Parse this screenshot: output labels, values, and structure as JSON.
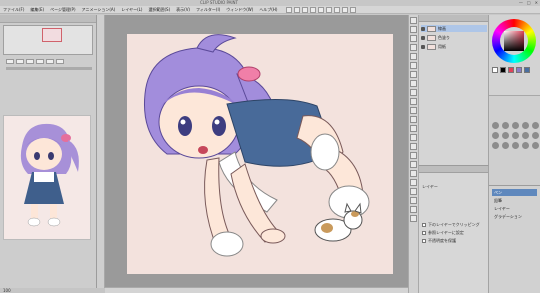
{
  "window": {
    "title": "CLIP STUDIO PAINT",
    "buttons": [
      "—",
      "□",
      "✕"
    ]
  },
  "menu": [
    "ファイル(F)",
    "編集(E)",
    "ページ管理(P)",
    "アニメーション(A)",
    "レイヤー(L)",
    "選択範囲(S)",
    "表示(V)",
    "フィルター(I)",
    "ウィンドウ(W)",
    "ヘルプ(H)"
  ],
  "layers": {
    "items": [
      {
        "label": "線画"
      },
      {
        "label": "色塗り"
      },
      {
        "label": "用紙"
      }
    ]
  },
  "properties": {
    "title": "レイヤー",
    "rows": [
      "下のレイヤーでクリッピング",
      "参照レイヤーに設定",
      "不透明度を保護"
    ]
  },
  "sub_tool": {
    "items": [
      "ペン",
      "鉛筆",
      "レイヤー",
      "グラデーション"
    ]
  },
  "status": {
    "zoom": "100"
  },
  "colors": {
    "canvas_bg": "#f3e2dd",
    "accent": "#5f88bd",
    "swatches": [
      "#ffffff",
      "#000000",
      "#e0425a",
      "#8a7cc7",
      "#4a6fa0"
    ]
  }
}
